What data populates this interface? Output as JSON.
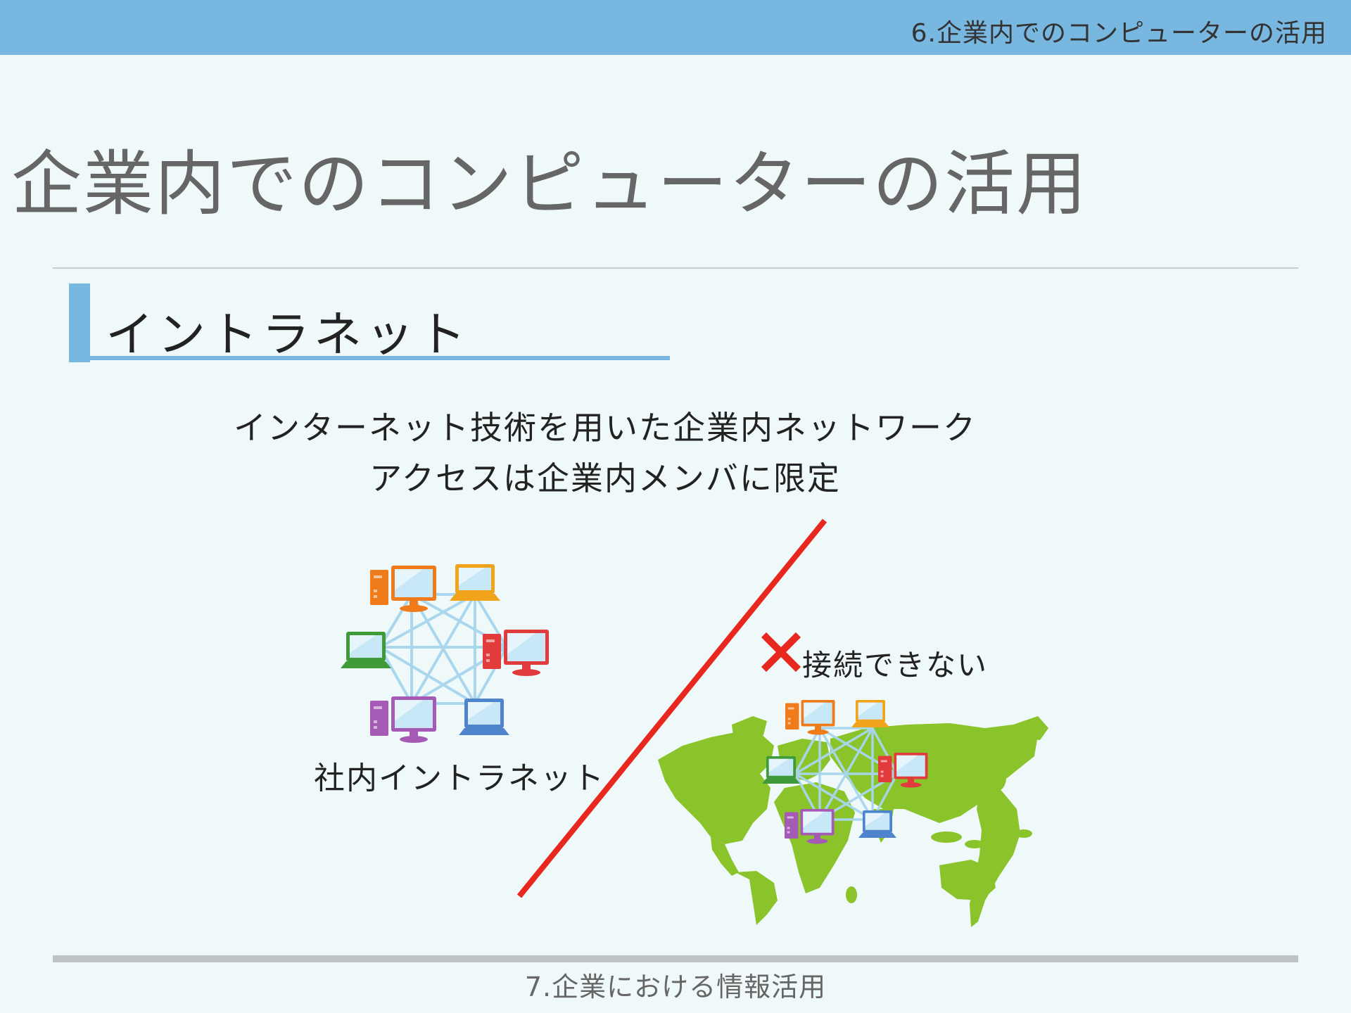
{
  "header": {
    "section_title": "6.企業内でのコンピューターの活用"
  },
  "slide": {
    "title": "企業内でのコンピューターの活用",
    "subheading": "イントラネット",
    "description": [
      "インターネット技術を用いた企業内ネットワーク",
      "アクセスは企業内メンバに限定"
    ],
    "intranet_caption": "社内イントラネット",
    "no_connection_label": "接続できない"
  },
  "footer": {
    "next_section": "7.企業における情報活用"
  },
  "colors": {
    "header_bar": "#77b7e0",
    "accent": "#77b7e0",
    "divider_line": "#e8281e",
    "cross_mark": "#e8281e",
    "map_land": "#8bc32a",
    "network_lines": "#a8d6ee"
  },
  "icons": {
    "intranet_network": [
      "desktop-orange",
      "laptop-orange",
      "desktop-red",
      "laptop-blue",
      "desktop-purple",
      "laptop-green"
    ],
    "world_network": [
      "desktop-orange",
      "laptop-orange",
      "desktop-red",
      "laptop-blue",
      "desktop-purple",
      "laptop-green"
    ],
    "world_map": "world-map-icon",
    "cross": "cross-icon"
  }
}
